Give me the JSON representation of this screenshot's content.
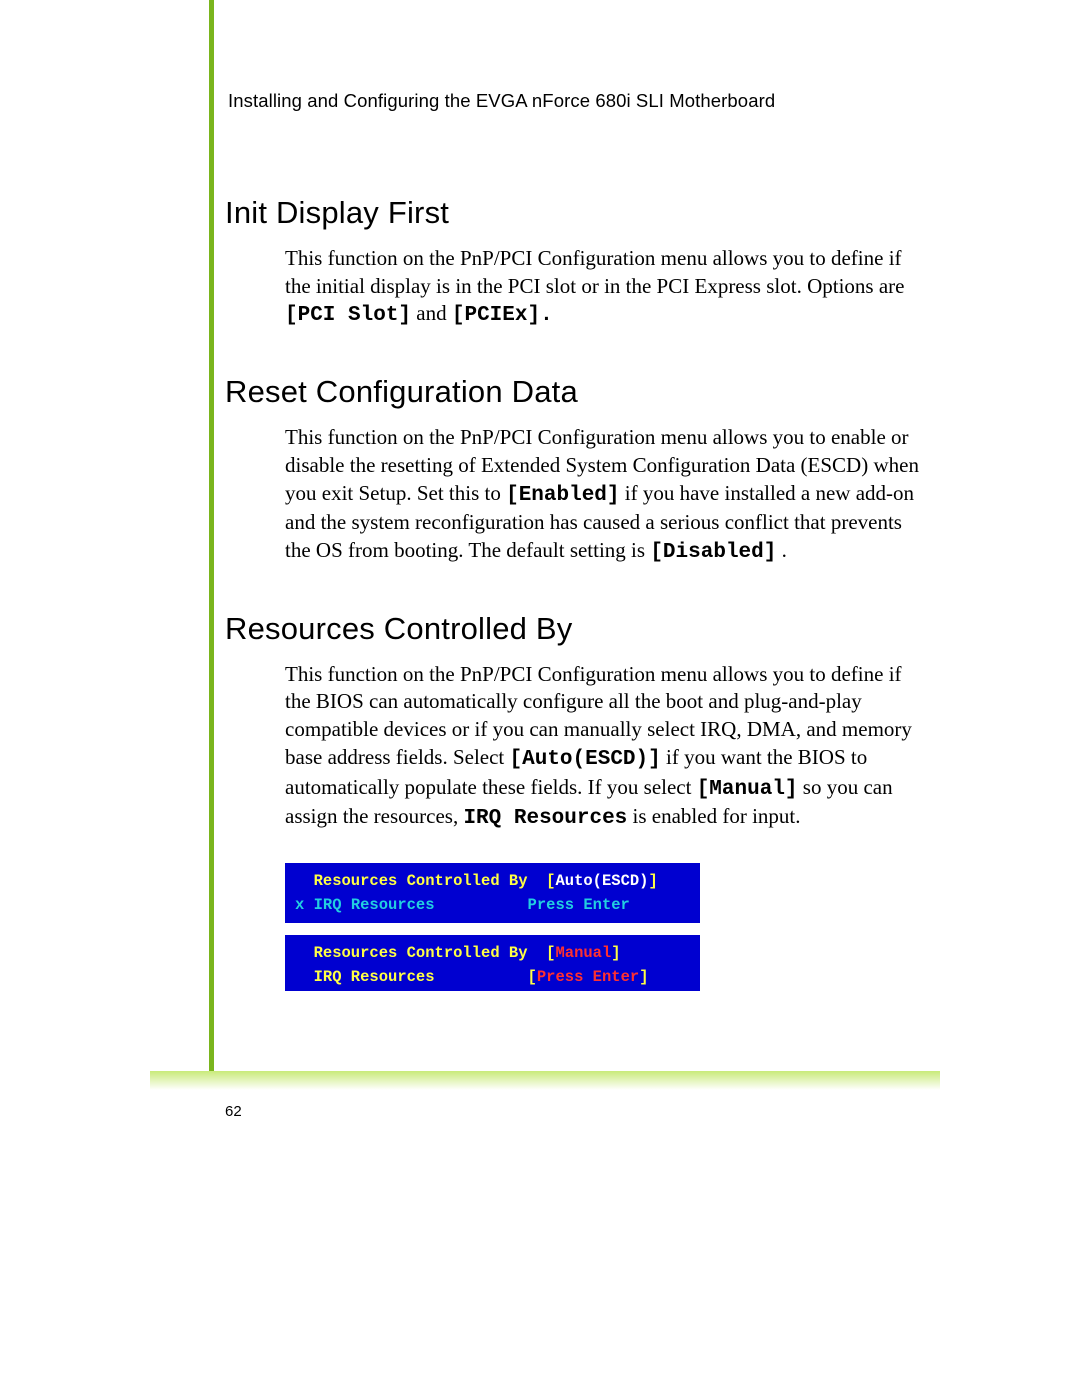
{
  "runningHead": "Installing and Configuring the EVGA nForce 680i SLI Motherboard",
  "pageNumber": "62",
  "sections": {
    "init": {
      "title": "Init Display First",
      "para_lead": "This function on the PnP/PCI Configuration menu allows you to define if the initial display is in the PCI slot or in the PCI Express slot. Options are ",
      "opt1": "[PCI Slot]",
      "mid": " and ",
      "opt2": "[PCIEx]."
    },
    "reset": {
      "title": "Reset Configuration Data",
      "p1": "This function on the PnP/PCI Configuration menu allows you to enable or disable the resetting of Extended System Configuration Data (ESCD) when you exit Setup. Set this to ",
      "enabled": "[Enabled]",
      "p2": " if you have installed a new add-on and the system reconfiguration has caused a serious conflict that prevents the OS from booting. The default setting is ",
      "disabled": "[Disabled]",
      "tail": "."
    },
    "res": {
      "title": "Resources Controlled By",
      "p1": "This function on the PnP/PCI Configuration menu allows you to define if the BIOS can automatically configure all the boot and plug-and-play compatible devices or if you can manually select IRQ, DMA, and memory base address fields. Select ",
      "auto": "[Auto(ESCD)]",
      "p2": " if you want the BIOS to automatically populate these fields. If you select ",
      "manual": "[Manual]",
      "p3": " so you can assign the resources, ",
      "irq": "IRQ Resources",
      "p4": " is enabled for input."
    }
  },
  "bios": {
    "box1": {
      "row1_label": "  Resources Controlled By  ",
      "row1_bracketL": "[",
      "row1_opt": "Auto(ESCD)",
      "row1_bracketR": "]",
      "row2_prefix": "x ",
      "row2_label": "IRQ Resources          ",
      "row2_action": "Press Enter"
    },
    "box2": {
      "row1_label": "  Resources Controlled By  ",
      "row1_bracketL": "[",
      "row1_opt": "Manual",
      "row1_bracketR": "]",
      "row2_label": "  IRQ Resources          ",
      "row2_bracketL": "[",
      "row2_action": "Press Enter",
      "row2_bracketR": "]"
    }
  }
}
